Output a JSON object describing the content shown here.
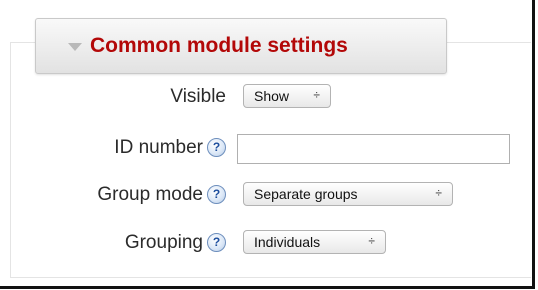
{
  "section": {
    "title": "Common module settings",
    "collapse_icon": "triangle-down-icon"
  },
  "fields": {
    "visible": {
      "label": "Visible",
      "value": "Show"
    },
    "id_number": {
      "label": "ID number",
      "help": "?",
      "value": "",
      "placeholder": ""
    },
    "group_mode": {
      "label": "Group mode",
      "help": "?",
      "value": "Separate groups"
    },
    "grouping": {
      "label": "Grouping",
      "help": "?",
      "value": "Individuals"
    }
  },
  "select_arrow": "÷",
  "colors": {
    "title": "#b30808",
    "help_icon": "#1e4f9e"
  }
}
